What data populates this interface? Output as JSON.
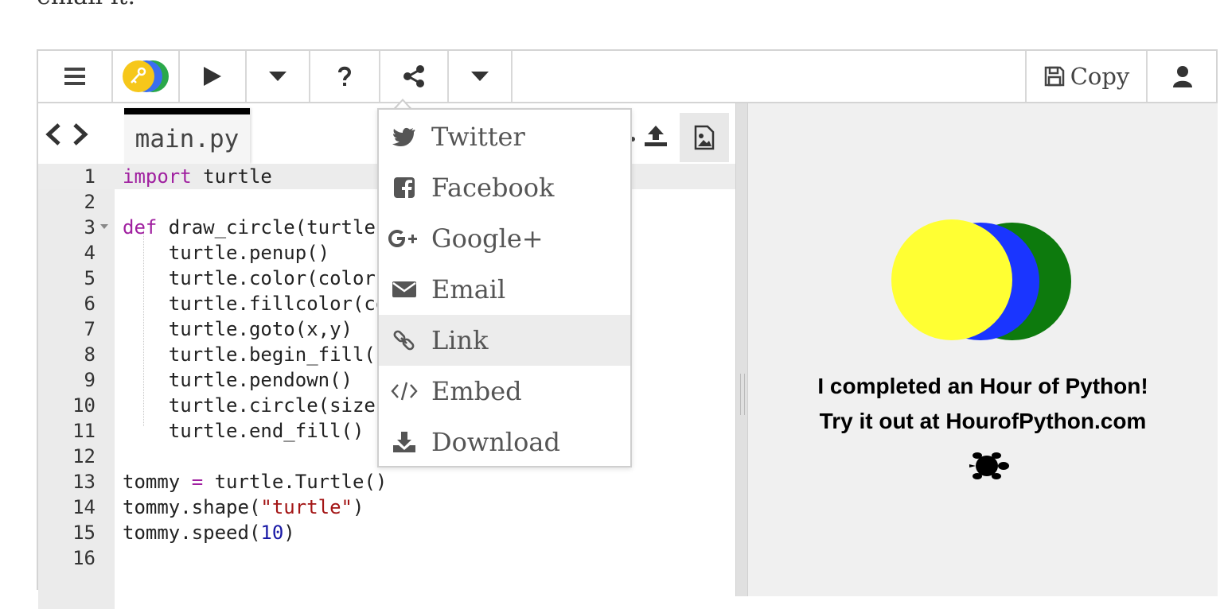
{
  "intro_text": "email it.",
  "toolbar": {
    "copy_label": "Copy"
  },
  "editor": {
    "file_tab": "main.py",
    "lines": [
      {
        "n": "1",
        "parts": [
          {
            "t": "import",
            "c": "kw"
          },
          {
            "t": " turtle",
            "c": ""
          }
        ]
      },
      {
        "n": "2",
        "parts": []
      },
      {
        "n": "3",
        "parts": [
          {
            "t": "def",
            "c": "kw"
          },
          {
            "t": " draw_circle(turtle,",
            "c": ""
          }
        ]
      },
      {
        "n": "4",
        "parts": [
          {
            "t": "    turtle.penup()",
            "c": ""
          }
        ]
      },
      {
        "n": "5",
        "parts": [
          {
            "t": "    turtle.color(color)",
            "c": ""
          }
        ]
      },
      {
        "n": "6",
        "parts": [
          {
            "t": "    turtle.fillcolor(co",
            "c": ""
          }
        ]
      },
      {
        "n": "7",
        "parts": [
          {
            "t": "    turtle.goto(x,y)",
            "c": ""
          }
        ]
      },
      {
        "n": "8",
        "parts": [
          {
            "t": "    turtle.begin_fill()",
            "c": ""
          }
        ]
      },
      {
        "n": "9",
        "parts": [
          {
            "t": "    turtle.pendown()",
            "c": ""
          }
        ]
      },
      {
        "n": "10",
        "parts": [
          {
            "t": "    turtle.circle(size)",
            "c": ""
          }
        ]
      },
      {
        "n": "11",
        "parts": [
          {
            "t": "    turtle.end_fill()",
            "c": ""
          }
        ]
      },
      {
        "n": "12",
        "parts": []
      },
      {
        "n": "13",
        "parts": [
          {
            "t": "tommy ",
            "c": ""
          },
          {
            "t": "=",
            "c": "kw"
          },
          {
            "t": " turtle.Turtle()",
            "c": ""
          }
        ]
      },
      {
        "n": "14",
        "parts": [
          {
            "t": "tommy.shape(",
            "c": ""
          },
          {
            "t": "\"turtle\"",
            "c": "str"
          },
          {
            "t": ")",
            "c": ""
          }
        ]
      },
      {
        "n": "15",
        "parts": [
          {
            "t": "tommy.speed(",
            "c": ""
          },
          {
            "t": "10",
            "c": "num"
          },
          {
            "t": ")",
            "c": ""
          }
        ]
      },
      {
        "n": "16",
        "parts": []
      }
    ]
  },
  "output": {
    "line1": "I completed an Hour of Python!",
    "line2": "Try it out at HourofPython.com",
    "circle_colors": [
      "#ffff33",
      "#1a35ff",
      "#0d7a0d"
    ]
  },
  "share_menu": {
    "items": [
      {
        "label": "Twitter",
        "icon": "twitter-icon"
      },
      {
        "label": "Facebook",
        "icon": "facebook-icon"
      },
      {
        "label": "Google+",
        "icon": "google-plus-icon"
      },
      {
        "label": "Email",
        "icon": "envelope-icon"
      },
      {
        "label": "Link",
        "icon": "link-icon"
      },
      {
        "label": "Embed",
        "icon": "code-icon"
      },
      {
        "label": "Download",
        "icon": "download-icon"
      }
    ],
    "highlighted": "Link"
  }
}
